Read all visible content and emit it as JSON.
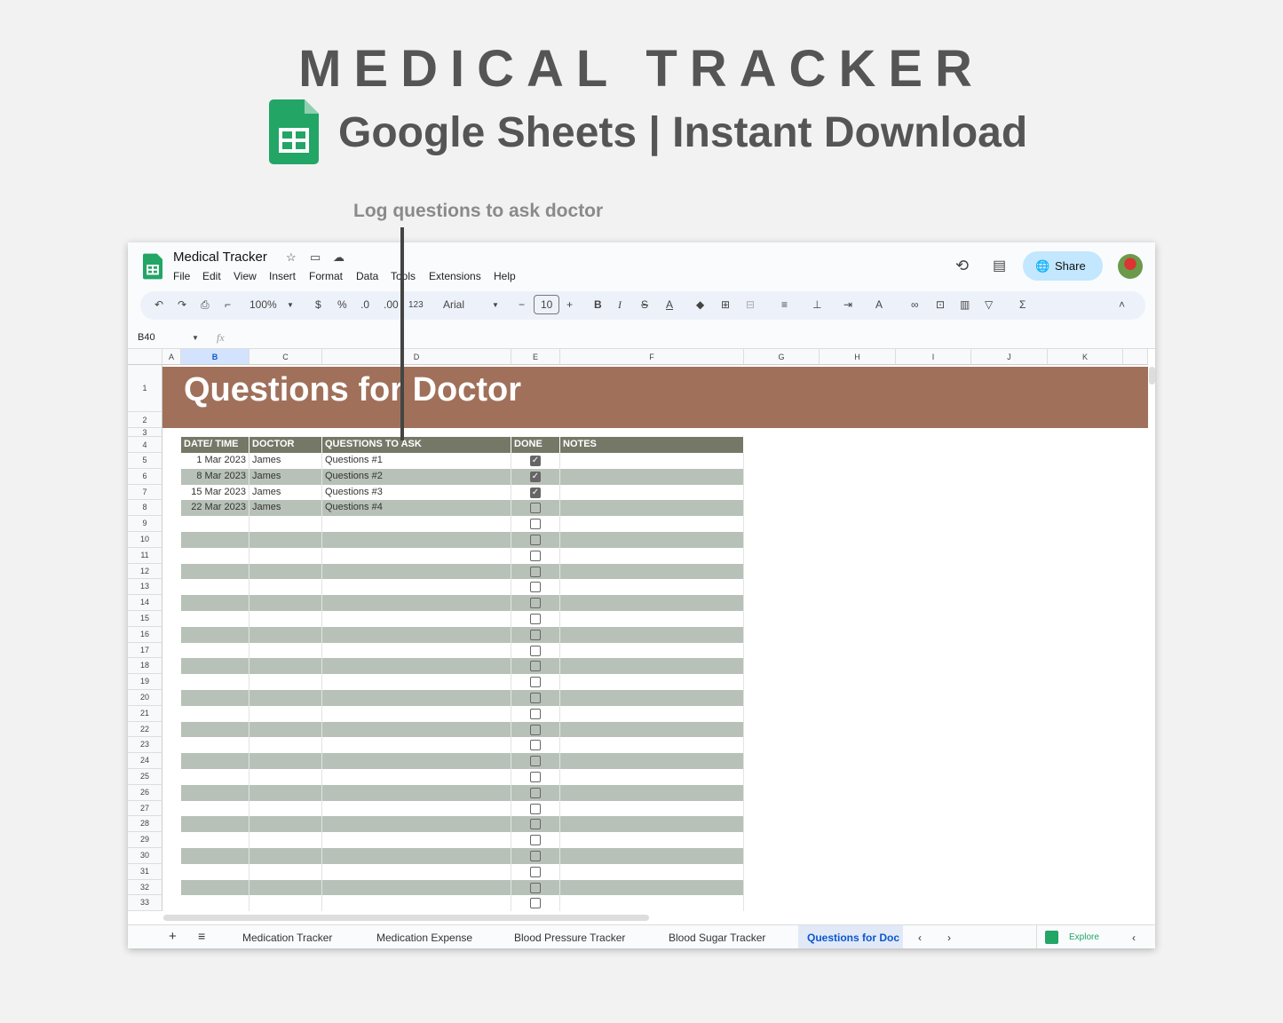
{
  "hero": {
    "title": "MEDICAL TRACKER",
    "subtitle": "Google Sheets | Instant Download",
    "callout": "Log questions to ask doctor"
  },
  "app": {
    "doc_title": "Medical Tracker",
    "menu": [
      "File",
      "Edit",
      "View",
      "Insert",
      "Format",
      "Data",
      "Tools",
      "Extensions",
      "Help"
    ],
    "share_label": "Share"
  },
  "toolbar": {
    "zoom": "100%",
    "currency": "$",
    "percent": "%",
    "dec_less": ".0",
    "dec_more": ".00",
    "format_123": "123",
    "font": "Arial",
    "font_size": "10"
  },
  "formula_bar": {
    "cell_ref": "B40",
    "fx": "fx"
  },
  "columns": [
    "A",
    "B",
    "C",
    "D",
    "E",
    "F",
    "G",
    "H",
    "I",
    "J",
    "K"
  ],
  "row_numbers": [
    "1",
    "2",
    "3",
    "4",
    "5",
    "6",
    "7",
    "8",
    "9",
    "10",
    "11",
    "12",
    "13",
    "14",
    "15",
    "16",
    "17",
    "18",
    "19",
    "20",
    "21",
    "22",
    "23",
    "24",
    "25",
    "26",
    "27",
    "28",
    "29",
    "30",
    "31",
    "32",
    "33"
  ],
  "sheet": {
    "banner_title": "Questions for Doctor",
    "headers": [
      "DATE/ TIME",
      "DOCTOR",
      "QUESTIONS TO ASK",
      "DONE",
      "NOTES"
    ],
    "rows": [
      {
        "date": "1 Mar 2023",
        "doctor": "James",
        "question": "Questions #1",
        "done": true,
        "notes": ""
      },
      {
        "date": "8 Mar 2023",
        "doctor": "James",
        "question": "Questions #2",
        "done": true,
        "notes": ""
      },
      {
        "date": "15 Mar 2023",
        "doctor": "James",
        "question": "Questions #3",
        "done": true,
        "notes": ""
      },
      {
        "date": "22 Mar 2023",
        "doctor": "James",
        "question": "Questions #4",
        "done": false,
        "notes": ""
      }
    ],
    "empty_rows": 25
  },
  "tabs": [
    "Medication Tracker",
    "Medication Expense",
    "Blood Pressure Tracker",
    "Blood Sugar Tracker",
    "Questions for Doc"
  ],
  "active_tab": "Questions for Doc",
  "explore_label": "Explore",
  "colors": {
    "banner": "#a0705a",
    "header": "#767867",
    "stripe": "#b8c1b8",
    "sheets_green": "#23a566",
    "active_tab": "#0b57d0"
  }
}
